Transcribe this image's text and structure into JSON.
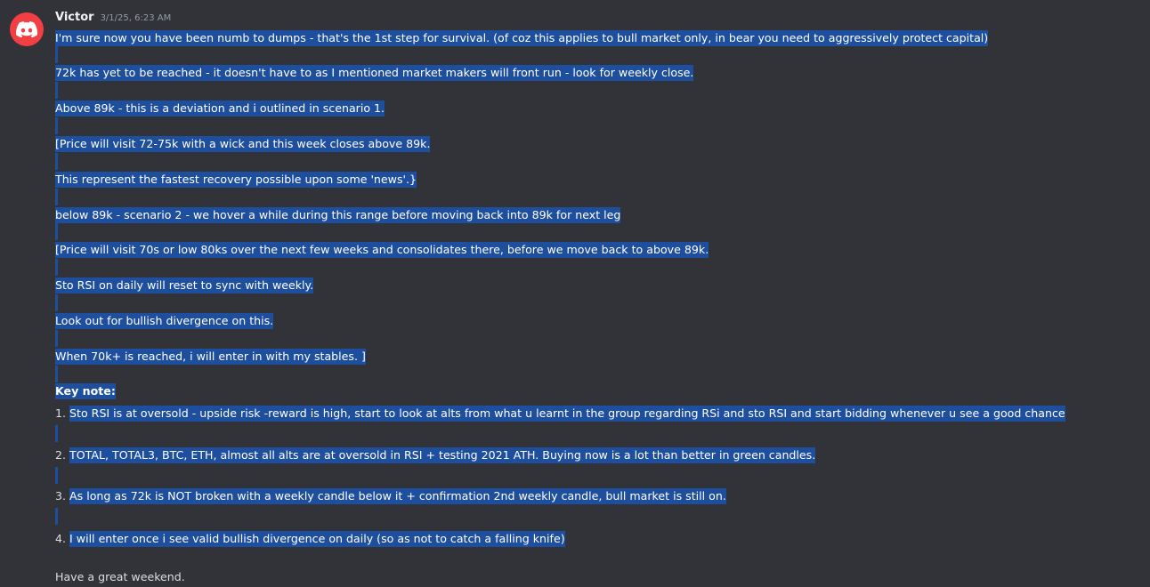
{
  "message": {
    "author": "Victor",
    "timestamp": "3/1/25, 6:23 AM",
    "lines": [
      "I'm sure now you have been numb to dumps - that's the 1st step for survival. (of coz this applies to bull market only, in bear you need to aggressively protect capital)",
      "72k has yet to be reached - it doesn't have to as I mentioned market makers will front run - look for weekly close.",
      "Above 89k - this is a deviation and i outlined in scenario 1.",
      "[Price will visit 72-75k with a wick and this week closes above 89k.",
      "This represent the fastest recovery possible upon some 'news'.}",
      "below 89k - scenario 2 - we hover a while during this range before moving back into 89k for next leg",
      "[Price will visit 70s or low 80ks over the next few weeks and consolidates there, before we move back to above 89k.",
      "Sto RSI on daily will reset to sync with weekly.",
      "Look out for bullish divergence on this.",
      "When 70k+ is reached, i will enter in with my stables. ]"
    ],
    "key_note_label": "Key note:",
    "key_points": [
      {
        "num": "1.",
        "text": "Sto RSI is at oversold - upside risk -reward is high, start to look at alts from what u learnt in the group regarding RSi and sto RSI and start bidding whenever u see a good chance"
      },
      {
        "num": "2.",
        "text": "TOTAL, TOTAL3, BTC, ETH, almost all alts are at oversold in RSI + testing 2021 ATH. Buying now is a lot than better in green candles."
      },
      {
        "num": "3.",
        "text": "As long as 72k is NOT broken with a weekly candle below it + confirmation 2nd weekly candle, bull market is still on."
      },
      {
        "num": "4.",
        "text": "I will enter once i see valid bullish divergence on daily (so as not to catch a falling knife)"
      }
    ],
    "signoff": "Have a great weekend."
  },
  "colors": {
    "background": "#323339",
    "selection": "#1e4f9e",
    "avatar": "#f23f43"
  },
  "icons": {
    "avatar": "discord-logo-icon"
  }
}
